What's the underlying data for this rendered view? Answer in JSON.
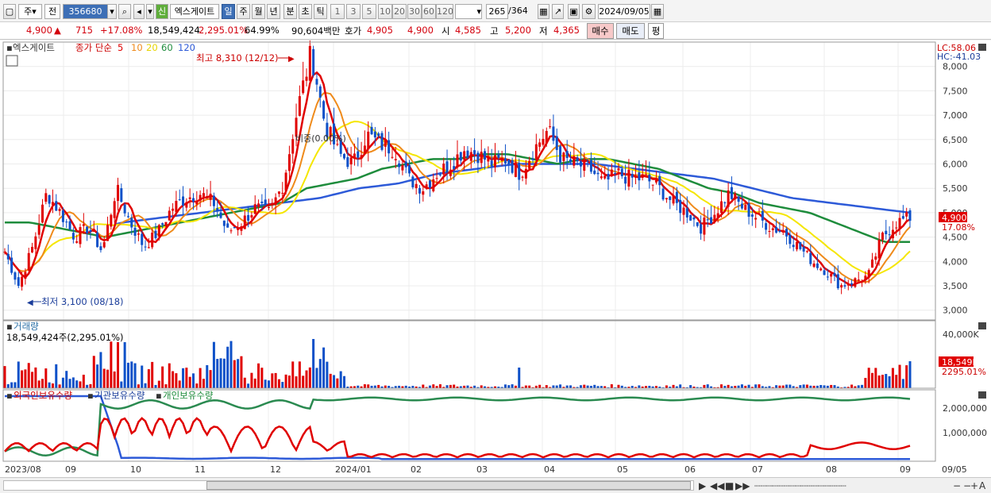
{
  "toolbar": {
    "market": "주",
    "prefix": "전",
    "code": "356680",
    "company": "엑스게이트",
    "periods": [
      "일",
      "주",
      "월",
      "년",
      "분",
      "초",
      "틱"
    ],
    "active_period": "일",
    "intervals": [
      "1",
      "3",
      "5",
      "10",
      "20",
      "30",
      "60",
      "120"
    ],
    "count": "265",
    "total": "/364",
    "date": "2024/09/05",
    "market_tag": "신"
  },
  "quote": {
    "price": "4,900",
    "arrow": "▲",
    "change": "715",
    "change_pct": "+17.08%",
    "volume": "18,549,424",
    "volume_pct": "2,295.01%",
    "ratio": "64.99%",
    "amount": "90,604백만",
    "bid_label": "호가",
    "bid1": "4,905",
    "bid2": "4,900",
    "open_label": "시",
    "open": "4,585",
    "high_label": "고",
    "high": "5,200",
    "low_label": "저",
    "low": "4,365",
    "buy": "매수",
    "sell": "매도",
    "flat": "평"
  },
  "legend": {
    "name": "엑스게이트",
    "label": "종가 단순",
    "ma": [
      "5",
      "10",
      "20",
      "60",
      "120"
    ]
  },
  "annotations": {
    "high": "최고 8,310 (12/12)",
    "low": "최저 3,100 (08/18)",
    "mid": "비중(0.00%)"
  },
  "right_labels": {
    "lc": "LC:58.06",
    "hc": "HC:-41.03",
    "price_tag": "4,900",
    "pct_tag": "17.08%",
    "vol_tag": "18,549K",
    "vol_pct_tag": "2295.01%"
  },
  "volume_panel": {
    "title": "거래량",
    "subtitle": "18,549,424주(2,295.01%)",
    "ticks": [
      "40,000K"
    ]
  },
  "holdings_panel": {
    "series": [
      "외국인보유수량",
      "기관보유수량",
      "개인보유수량"
    ],
    "ticks": [
      "2,000,000",
      "1,000,000"
    ]
  },
  "x_labels": [
    "2023/08",
    "09",
    "10",
    "11",
    "12",
    "2024/01",
    "02",
    "03",
    "04",
    "05",
    "06",
    "07",
    "08",
    "09"
  ],
  "x_right_label": "09/05",
  "chart_data": {
    "type": "candlestick",
    "title": "",
    "y_ticks": [
      8000,
      7500,
      7000,
      6500,
      6000,
      5500,
      5000,
      4500,
      4000,
      3500,
      3000
    ],
    "ylim": [
      2800,
      8500
    ],
    "colors": {
      "up": "#e00000",
      "down": "#0d50c8",
      "ma5": "#e00000",
      "ma10": "#ef8a1a",
      "ma20": "#f5e600",
      "ma60": "#1e8c3c",
      "ma120": "#2d5ad8"
    },
    "months": [
      "2023/08",
      "09",
      "10",
      "11",
      "12",
      "2024/01",
      "02",
      "03",
      "04",
      "05",
      "06",
      "07",
      "08",
      "09"
    ],
    "close_path": [
      4200,
      3500,
      4300,
      5400,
      5000,
      4500,
      4700,
      4200,
      5500,
      4800,
      4300,
      4600,
      5100,
      5300,
      5400,
      5200,
      4600,
      4800,
      5100,
      5000,
      5600,
      7100,
      8300,
      6800,
      6200,
      6000,
      6600,
      6400,
      6300,
      5700,
      5500,
      5800,
      6000,
      6300,
      6200,
      6000,
      6100,
      5800,
      6300,
      6700,
      6100,
      6000,
      5900,
      5600,
      5800,
      5700,
      5700,
      5500,
      5200,
      5000,
      4700,
      5000,
      5400,
      5100,
      4900,
      4700,
      4600,
      4300,
      4000,
      3800,
      3500,
      3600,
      3700,
      4500,
      4800,
      4900
    ],
    "ma60_path": [
      4800,
      4800,
      4700,
      4600,
      4500,
      4600,
      4700,
      4800,
      4900,
      5000,
      5100,
      5200,
      5500,
      5600,
      5700,
      5900,
      6000,
      6100,
      6100,
      6200,
      6200,
      6100,
      6000,
      6100,
      6100,
      6000,
      5900,
      5700,
      5500,
      5400,
      5200,
      5100,
      5000,
      4800,
      4600,
      4400,
      4400
    ],
    "ma120_path": [
      4300,
      4400,
      4600,
      4800,
      4900,
      5000,
      5100,
      5200,
      5300,
      5500,
      5600,
      5800,
      5900,
      6000,
      6000,
      6000,
      5900,
      5800,
      5700,
      5500,
      5300,
      5200,
      5100,
      5000
    ],
    "holdings": {
      "foreign": "0~700K oscillating, high ~1.9M in 11-12",
      "institution": "2.3M until 09 then near 0",
      "individual": "~2.2M from 09 onwards"
    },
    "holdings_ticks": [
      2000000,
      1000000
    ]
  }
}
